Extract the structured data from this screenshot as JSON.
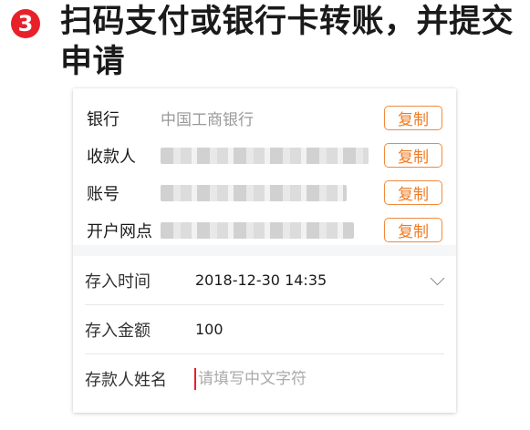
{
  "step": {
    "number": "3",
    "title": "扫码支付或银行卡转账，并提交申请"
  },
  "bank_info": {
    "rows": [
      {
        "label": "银行",
        "value": "中国工商银行",
        "copy_label": "复制"
      },
      {
        "label": "收款人",
        "value": "",
        "copy_label": "复制"
      },
      {
        "label": "账号",
        "value": "",
        "copy_label": "复制"
      },
      {
        "label": "开户网点",
        "value": "",
        "copy_label": "复制"
      }
    ]
  },
  "form": {
    "deposit_time": {
      "label": "存入时间",
      "value": "2018-12-30 14:35"
    },
    "deposit_amount": {
      "label": "存入金额",
      "value": "100"
    },
    "depositor_name": {
      "label": "存款人姓名",
      "value": "",
      "placeholder": "请填写中文字符"
    }
  },
  "colors": {
    "accent": "#e8202a",
    "copy_button": "#f07b22"
  }
}
